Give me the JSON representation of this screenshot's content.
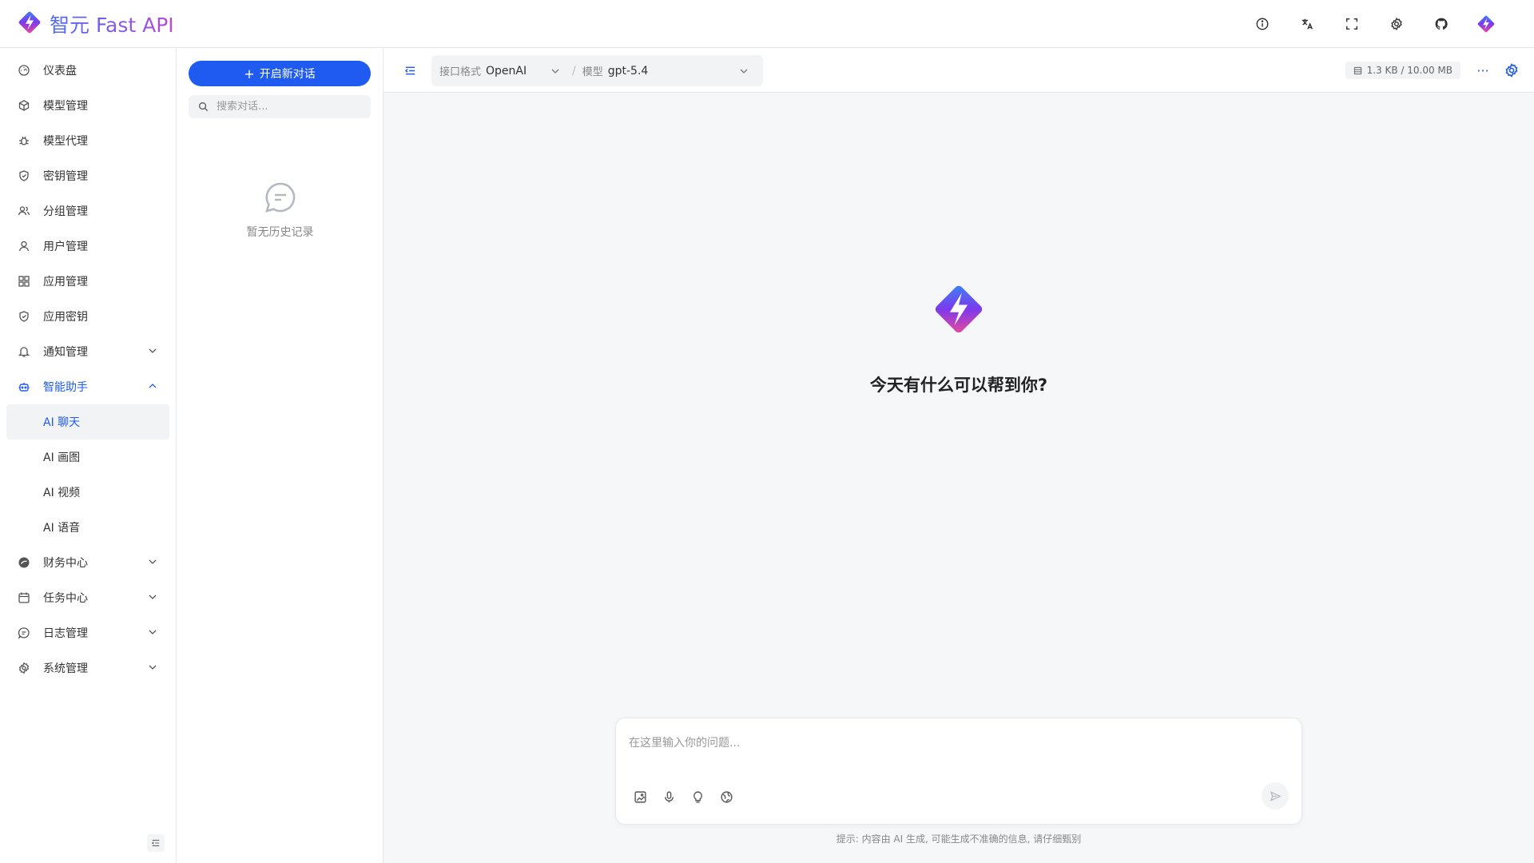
{
  "brand": {
    "name": "智元 Fast API",
    "icon": "logo-icon"
  },
  "header": {
    "actions": [
      {
        "icon": "info-icon"
      },
      {
        "icon": "translate-icon"
      },
      {
        "icon": "fullscreen-icon"
      },
      {
        "icon": "settings-icon"
      },
      {
        "icon": "github-icon"
      },
      {
        "icon": "logo-icon"
      }
    ]
  },
  "nav": {
    "items": [
      {
        "label": "仪表盘",
        "icon": "dashboard-icon"
      },
      {
        "label": "模型管理",
        "icon": "cube-icon"
      },
      {
        "label": "模型代理",
        "icon": "bug-icon"
      },
      {
        "label": "密钥管理",
        "icon": "shield-icon"
      },
      {
        "label": "分组管理",
        "icon": "users-icon"
      },
      {
        "label": "用户管理",
        "icon": "user-icon"
      },
      {
        "label": "应用管理",
        "icon": "grid-icon"
      },
      {
        "label": "应用密钥",
        "icon": "shield-icon"
      },
      {
        "label": "通知管理",
        "icon": "bell-icon"
      },
      {
        "label": "智能助手",
        "icon": "robot-icon"
      },
      {
        "label": "财务中心",
        "icon": "wallet-icon"
      },
      {
        "label": "任务中心",
        "icon": "calendar-icon"
      },
      {
        "label": "日志管理",
        "icon": "log-icon"
      },
      {
        "label": "系统管理",
        "icon": "gear-icon"
      }
    ],
    "sub_items": [
      {
        "label": "AI 聊天"
      },
      {
        "label": "AI 画图"
      },
      {
        "label": "AI 视频"
      },
      {
        "label": "AI 语音"
      }
    ]
  },
  "history": {
    "new_chat": "开启新对话",
    "search_placeholder": "搜索对话...",
    "empty_text": "暂无历史记录"
  },
  "chat": {
    "format_label": "接口格式",
    "format_value": "OpenAI",
    "model_label": "模型",
    "model_value": "gpt-5.4",
    "size": "1.3 KB / 10.00 MB",
    "more": "···",
    "hero_title": "今天有什么可以帮到你?",
    "input_placeholder": "在这里输入你的问题...",
    "hint": "提示: 内容由 AI 生成, 可能生成不准确的信息, 请仔细甄别"
  },
  "colors": {
    "accent": "#1f5bf0",
    "brand_gradient_start": "#3b82f6",
    "brand_gradient_end": "#ec4899"
  }
}
